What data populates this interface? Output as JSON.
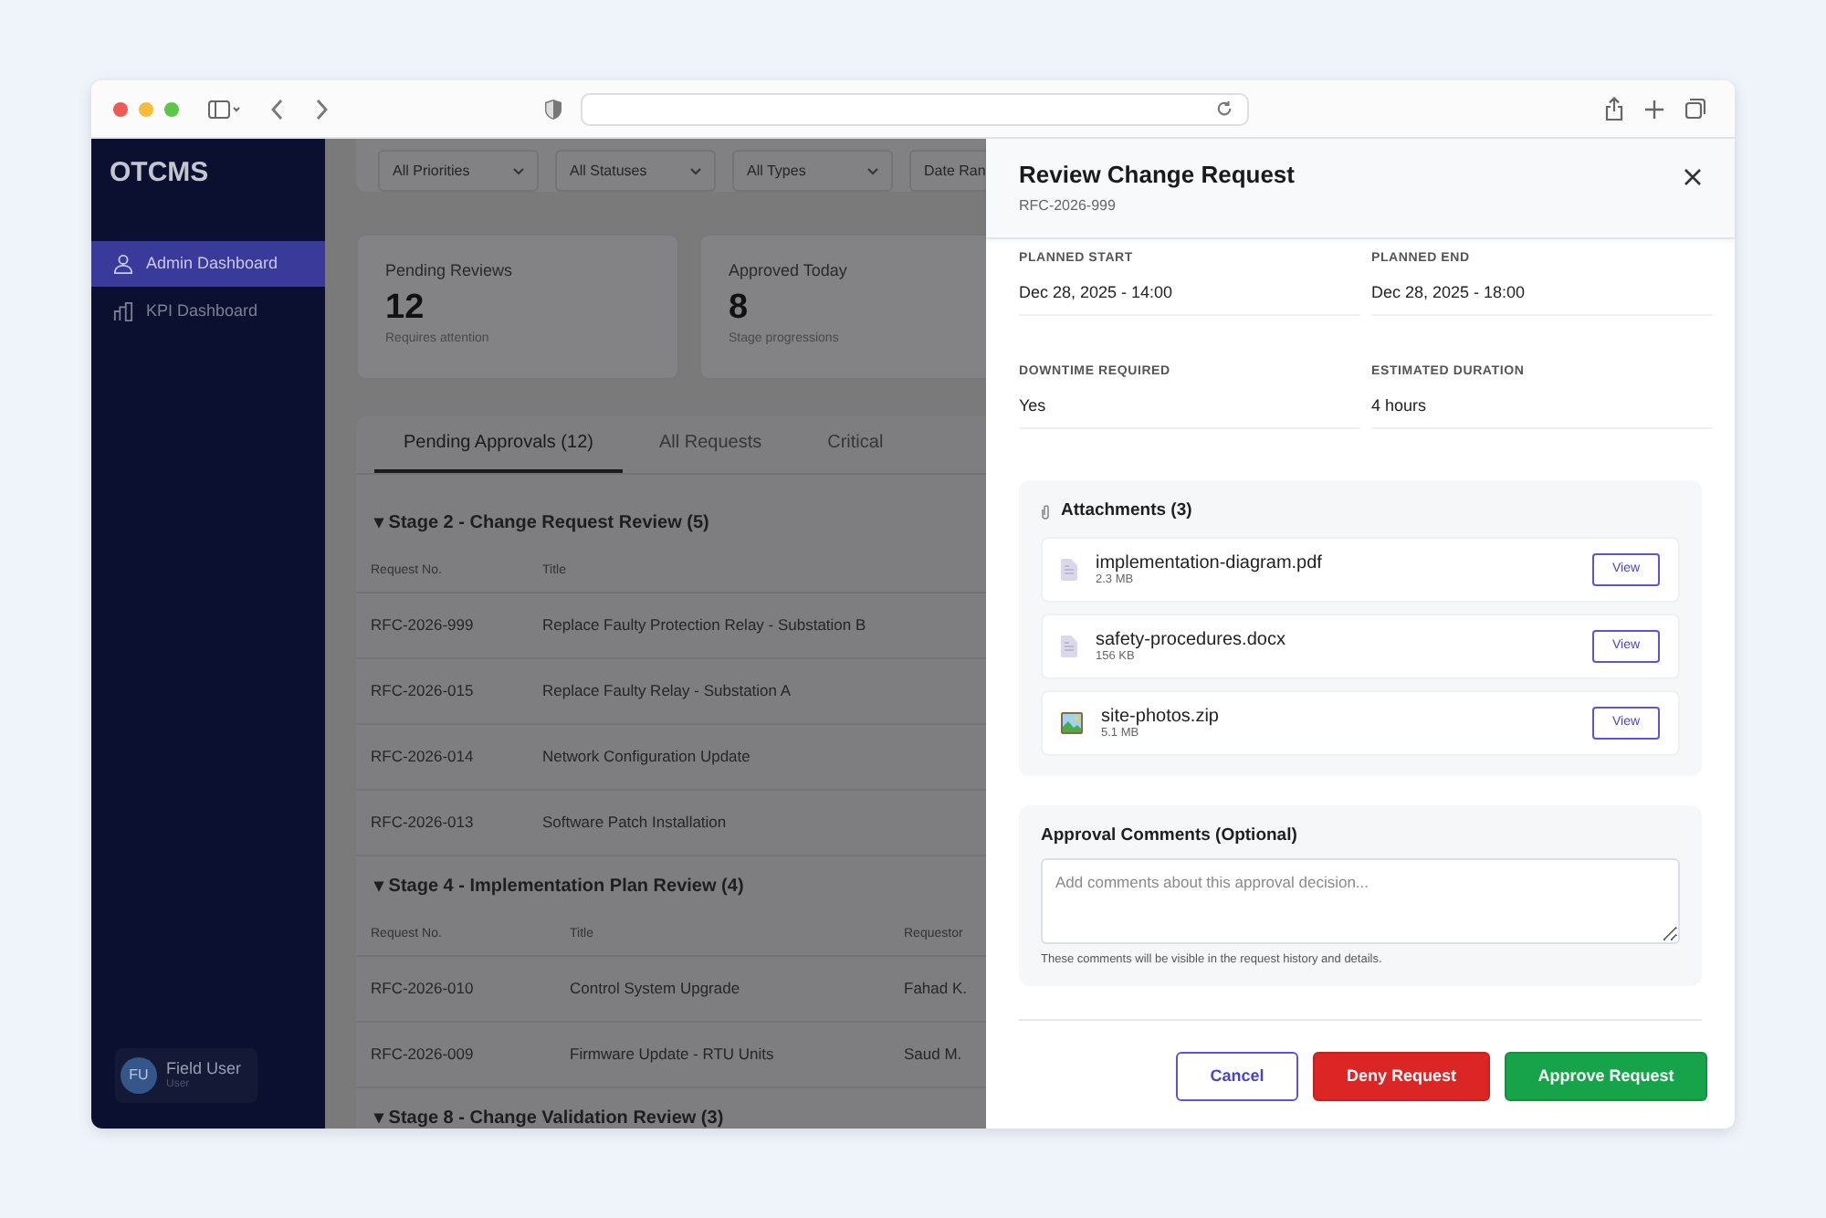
{
  "sidebar": {
    "brand": "OTCMS",
    "items": [
      {
        "label": "Admin Dashboard",
        "selected": true
      },
      {
        "label": "KPI Dashboard",
        "selected": false
      }
    ],
    "user": {
      "initials": "FU",
      "name": "Field User",
      "role": "User"
    }
  },
  "filters": [
    "All Priorities",
    "All Statuses",
    "All Types",
    "Date Ran"
  ],
  "stats": [
    {
      "label": "Pending Reviews",
      "value": "12",
      "note": "Requires attention"
    },
    {
      "label": "Approved Today",
      "value": "8",
      "note": "Stage progressions"
    }
  ],
  "tabs": [
    {
      "label": "Pending Approvals (12)",
      "selected": true
    },
    {
      "label": "All Requests",
      "selected": false
    },
    {
      "label": "Critical",
      "selected": false
    }
  ],
  "sections": [
    {
      "title": "▾ Stage 2 - Change Request Review (5)",
      "columns": [
        "Request No.",
        "Title"
      ],
      "rows": [
        [
          "RFC-2026-999",
          "Replace Faulty Protection Relay - Substation B"
        ],
        [
          "RFC-2026-015",
          "Replace Faulty Relay - Substation A"
        ],
        [
          "RFC-2026-014",
          "Network Configuration Update"
        ],
        [
          "RFC-2026-013",
          "Software Patch Installation"
        ]
      ]
    },
    {
      "title": "▾ Stage 4 - Implementation Plan Review (4)",
      "columns": [
        "Request No.",
        "Title",
        "Requestor"
      ],
      "rows": [
        [
          "RFC-2026-010",
          "Control System Upgrade",
          "Fahad K."
        ],
        [
          "RFC-2026-009",
          "Firmware Update - RTU Units",
          "Saud M."
        ]
      ]
    },
    {
      "title": "▾ Stage 8 - Change Validation Review (3)"
    }
  ],
  "drawer": {
    "title": "Review Change Request",
    "subtitle": "RFC-2026-999",
    "fields": [
      {
        "label": "PLANNED START",
        "value": "Dec 28, 2025 - 14:00"
      },
      {
        "label": "PLANNED END",
        "value": "Dec 28, 2025 - 18:00"
      },
      {
        "label": "DOWNTIME REQUIRED",
        "value": "Yes"
      },
      {
        "label": "ESTIMATED DURATION",
        "value": "4 hours"
      }
    ],
    "attachments": {
      "title": "Attachments (3)",
      "items": [
        {
          "name": "implementation-diagram.pdf",
          "size": "2.3 MB",
          "kind": "document",
          "action": "View"
        },
        {
          "name": "safety-procedures.docx",
          "size": "156 KB",
          "kind": "document",
          "action": "View"
        },
        {
          "name": "site-photos.zip",
          "size": "5.1 MB",
          "kind": "image",
          "action": "View"
        }
      ]
    },
    "comments": {
      "title": "Approval Comments (Optional)",
      "placeholder": "Add comments about this approval decision...",
      "hint": "These comments will be visible in the request history and details."
    },
    "buttons": [
      {
        "label": "Cancel",
        "kind": "cancel"
      },
      {
        "label": "Deny Request",
        "kind": "deny"
      },
      {
        "label": "Approve Request",
        "kind": "approve"
      }
    ]
  }
}
